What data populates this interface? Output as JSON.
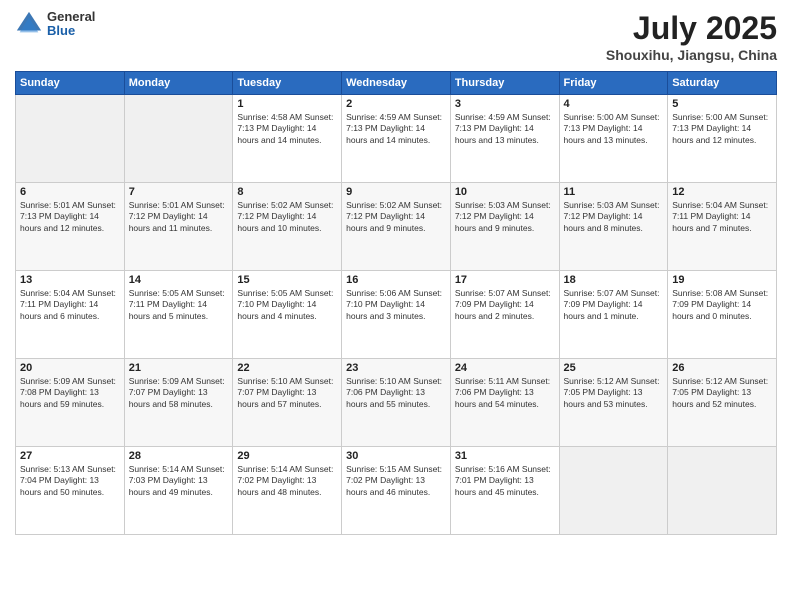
{
  "header": {
    "logo": {
      "general": "General",
      "blue": "Blue"
    },
    "title": "July 2025",
    "location": "Shouxihu, Jiangsu, China"
  },
  "days_of_week": [
    "Sunday",
    "Monday",
    "Tuesday",
    "Wednesday",
    "Thursday",
    "Friday",
    "Saturday"
  ],
  "weeks": [
    [
      {
        "day": "",
        "info": ""
      },
      {
        "day": "",
        "info": ""
      },
      {
        "day": "1",
        "info": "Sunrise: 4:58 AM\nSunset: 7:13 PM\nDaylight: 14 hours\nand 14 minutes."
      },
      {
        "day": "2",
        "info": "Sunrise: 4:59 AM\nSunset: 7:13 PM\nDaylight: 14 hours\nand 14 minutes."
      },
      {
        "day": "3",
        "info": "Sunrise: 4:59 AM\nSunset: 7:13 PM\nDaylight: 14 hours\nand 13 minutes."
      },
      {
        "day": "4",
        "info": "Sunrise: 5:00 AM\nSunset: 7:13 PM\nDaylight: 14 hours\nand 13 minutes."
      },
      {
        "day": "5",
        "info": "Sunrise: 5:00 AM\nSunset: 7:13 PM\nDaylight: 14 hours\nand 12 minutes."
      }
    ],
    [
      {
        "day": "6",
        "info": "Sunrise: 5:01 AM\nSunset: 7:13 PM\nDaylight: 14 hours\nand 12 minutes."
      },
      {
        "day": "7",
        "info": "Sunrise: 5:01 AM\nSunset: 7:12 PM\nDaylight: 14 hours\nand 11 minutes."
      },
      {
        "day": "8",
        "info": "Sunrise: 5:02 AM\nSunset: 7:12 PM\nDaylight: 14 hours\nand 10 minutes."
      },
      {
        "day": "9",
        "info": "Sunrise: 5:02 AM\nSunset: 7:12 PM\nDaylight: 14 hours\nand 9 minutes."
      },
      {
        "day": "10",
        "info": "Sunrise: 5:03 AM\nSunset: 7:12 PM\nDaylight: 14 hours\nand 9 minutes."
      },
      {
        "day": "11",
        "info": "Sunrise: 5:03 AM\nSunset: 7:12 PM\nDaylight: 14 hours\nand 8 minutes."
      },
      {
        "day": "12",
        "info": "Sunrise: 5:04 AM\nSunset: 7:11 PM\nDaylight: 14 hours\nand 7 minutes."
      }
    ],
    [
      {
        "day": "13",
        "info": "Sunrise: 5:04 AM\nSunset: 7:11 PM\nDaylight: 14 hours\nand 6 minutes."
      },
      {
        "day": "14",
        "info": "Sunrise: 5:05 AM\nSunset: 7:11 PM\nDaylight: 14 hours\nand 5 minutes."
      },
      {
        "day": "15",
        "info": "Sunrise: 5:05 AM\nSunset: 7:10 PM\nDaylight: 14 hours\nand 4 minutes."
      },
      {
        "day": "16",
        "info": "Sunrise: 5:06 AM\nSunset: 7:10 PM\nDaylight: 14 hours\nand 3 minutes."
      },
      {
        "day": "17",
        "info": "Sunrise: 5:07 AM\nSunset: 7:09 PM\nDaylight: 14 hours\nand 2 minutes."
      },
      {
        "day": "18",
        "info": "Sunrise: 5:07 AM\nSunset: 7:09 PM\nDaylight: 14 hours\nand 1 minute."
      },
      {
        "day": "19",
        "info": "Sunrise: 5:08 AM\nSunset: 7:09 PM\nDaylight: 14 hours\nand 0 minutes."
      }
    ],
    [
      {
        "day": "20",
        "info": "Sunrise: 5:09 AM\nSunset: 7:08 PM\nDaylight: 13 hours\nand 59 minutes."
      },
      {
        "day": "21",
        "info": "Sunrise: 5:09 AM\nSunset: 7:07 PM\nDaylight: 13 hours\nand 58 minutes."
      },
      {
        "day": "22",
        "info": "Sunrise: 5:10 AM\nSunset: 7:07 PM\nDaylight: 13 hours\nand 57 minutes."
      },
      {
        "day": "23",
        "info": "Sunrise: 5:10 AM\nSunset: 7:06 PM\nDaylight: 13 hours\nand 55 minutes."
      },
      {
        "day": "24",
        "info": "Sunrise: 5:11 AM\nSunset: 7:06 PM\nDaylight: 13 hours\nand 54 minutes."
      },
      {
        "day": "25",
        "info": "Sunrise: 5:12 AM\nSunset: 7:05 PM\nDaylight: 13 hours\nand 53 minutes."
      },
      {
        "day": "26",
        "info": "Sunrise: 5:12 AM\nSunset: 7:05 PM\nDaylight: 13 hours\nand 52 minutes."
      }
    ],
    [
      {
        "day": "27",
        "info": "Sunrise: 5:13 AM\nSunset: 7:04 PM\nDaylight: 13 hours\nand 50 minutes."
      },
      {
        "day": "28",
        "info": "Sunrise: 5:14 AM\nSunset: 7:03 PM\nDaylight: 13 hours\nand 49 minutes."
      },
      {
        "day": "29",
        "info": "Sunrise: 5:14 AM\nSunset: 7:02 PM\nDaylight: 13 hours\nand 48 minutes."
      },
      {
        "day": "30",
        "info": "Sunrise: 5:15 AM\nSunset: 7:02 PM\nDaylight: 13 hours\nand 46 minutes."
      },
      {
        "day": "31",
        "info": "Sunrise: 5:16 AM\nSunset: 7:01 PM\nDaylight: 13 hours\nand 45 minutes."
      },
      {
        "day": "",
        "info": ""
      },
      {
        "day": "",
        "info": ""
      }
    ]
  ]
}
